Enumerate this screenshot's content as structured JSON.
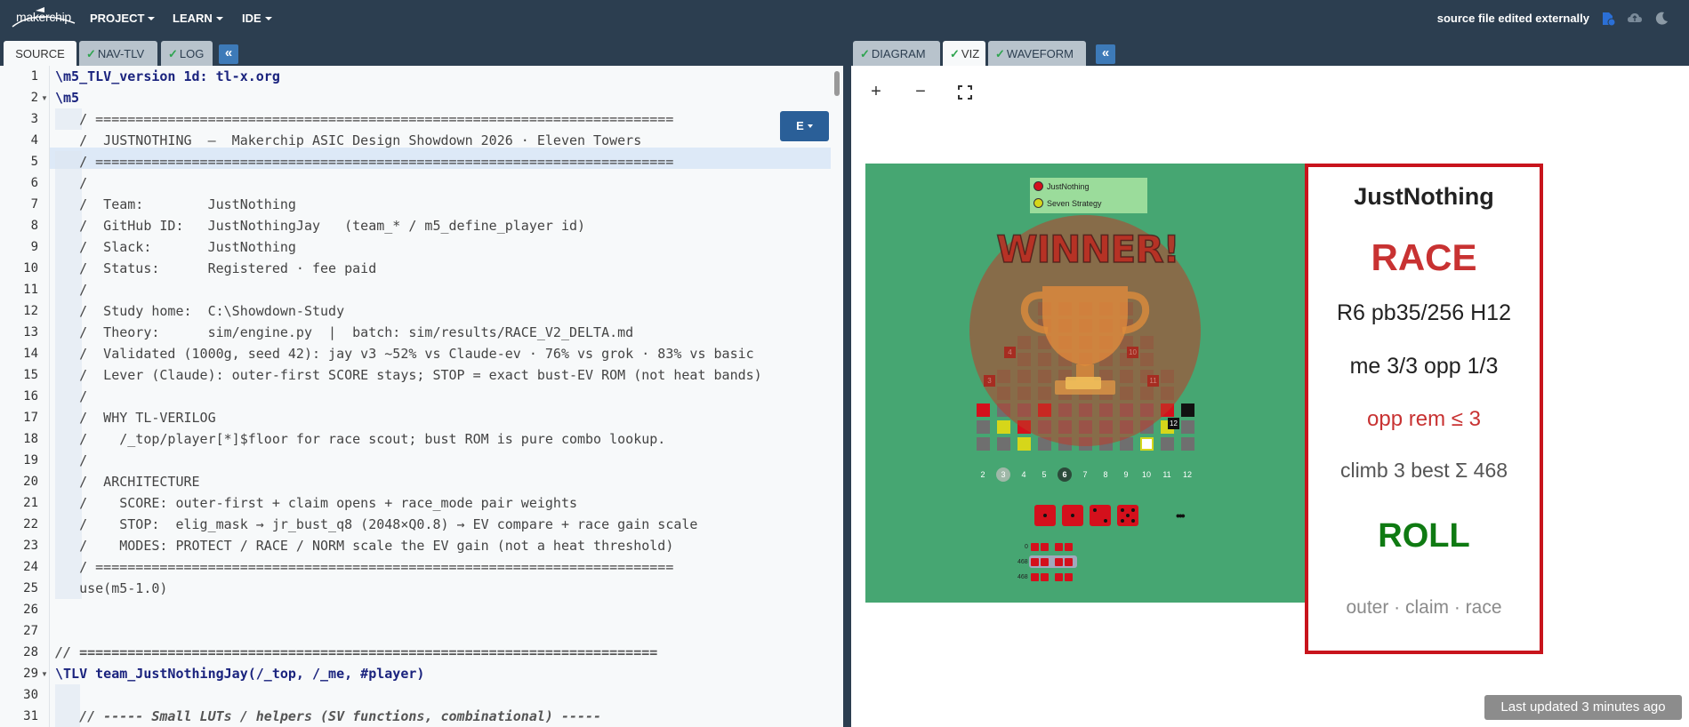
{
  "app": {
    "logo_text": "makerchip"
  },
  "menu": {
    "project": "PROJECT",
    "learn": "LEARN",
    "ide": "IDE"
  },
  "status": {
    "message": "source file edited externally"
  },
  "left_tabs": {
    "source": "SOURCE",
    "nav_tlv": "NAV-TLV",
    "log": "LOG",
    "collapse": "«"
  },
  "right_tabs": {
    "diagram": "DIAGRAM",
    "viz": "VIZ",
    "waveform": "WAVEFORM",
    "collapse": "«"
  },
  "editor": {
    "mode_button": "E",
    "line_numbers": [
      "1",
      "2",
      "3",
      "4",
      "5",
      "6",
      "7",
      "8",
      "9",
      "10",
      "11",
      "12",
      "13",
      "14",
      "15",
      "16",
      "17",
      "18",
      "19",
      "20",
      "21",
      "22",
      "23",
      "24",
      "25",
      "26",
      "27",
      "28",
      "29",
      "30",
      "31"
    ],
    "lines": [
      "\\m5_TLV_version 1d: tl-x.org",
      "\\m5",
      "   / ========================================================================",
      "   /  JUSTNOTHING  —  Makerchip ASIC Design Showdown 2026 · Eleven Towers",
      "   / ========================================================================",
      "   /",
      "   /  Team:        JustNothing",
      "   /  GitHub ID:   JustNothingJay   (team_* / m5_define_player id)",
      "   /  Slack:       JustNothing",
      "   /  Status:      Registered · fee paid",
      "   /",
      "   /  Study home:  C:\\Showdown-Study",
      "   /  Theory:      sim/engine.py  |  batch: sim/results/RACE_V2_DELTA.md",
      "   /  Validated (1000g, seed 42): jay v3 ~52% vs Claude-ev · 76% vs grok · 83% vs basic",
      "   /  Lever (Claude): outer-first SCORE stays; STOP = exact bust-EV ROM (not heat bands)",
      "   /",
      "   /  WHY TL-VERILOG",
      "   /    /_top/player[*]$floor for race scout; bust ROM is pure combo lookup.",
      "   /",
      "   /  ARCHITECTURE",
      "   /    SCORE: outer-first + claim opens + race_mode pair weights",
      "   /    STOP:  elig_mask → jr_bust_q8 (2048×Q0.8) → EV compare + race gain scale",
      "   /    MODES: PROTECT / RACE / NORM scale the EV gain (not a heat threshold)",
      "   / ========================================================================",
      "   use(m5-1.0)",
      "",
      "",
      "// ========================================================================",
      "\\TLV team_JustNothingJay(/_top, /_me, #player)",
      "",
      "   // ----- Small LUTs / helpers (SV functions, combinational) -----"
    ]
  },
  "viz": {
    "zoom_in": "+",
    "zoom_out": "−",
    "legend": [
      {
        "name": "JustNothing",
        "color": "#d4101c"
      },
      {
        "name": "Seven Strategy",
        "color": "#d6d61a"
      }
    ],
    "banner": "WINNER!",
    "column_numbers": [
      "2",
      "3",
      "4",
      "5",
      "6",
      "7",
      "8",
      "9",
      "10",
      "11",
      "12"
    ],
    "column_tags": {
      "c3": "3",
      "c4": "4",
      "c10": "10",
      "c11": "11",
      "c12": "12"
    },
    "more": "•••",
    "mini_rows": [
      "0",
      "468",
      "468"
    ]
  },
  "card": {
    "player": "JustNothing",
    "mode": "RACE",
    "stats_line": "R6  pb35/256  H12",
    "progress_line": "me 3/3   opp 1/3",
    "warning_line": "opp rem ≤ 3",
    "climb_line": "climb 3   best Σ 468",
    "action": "ROLL",
    "footer": "outer · claim · race",
    "colors": {
      "border": "#c8141c",
      "mode": "#c83232",
      "warning": "#c83232",
      "action": "#0f7a12"
    }
  },
  "footer": {
    "last_updated": "Last updated 3 minutes ago"
  }
}
